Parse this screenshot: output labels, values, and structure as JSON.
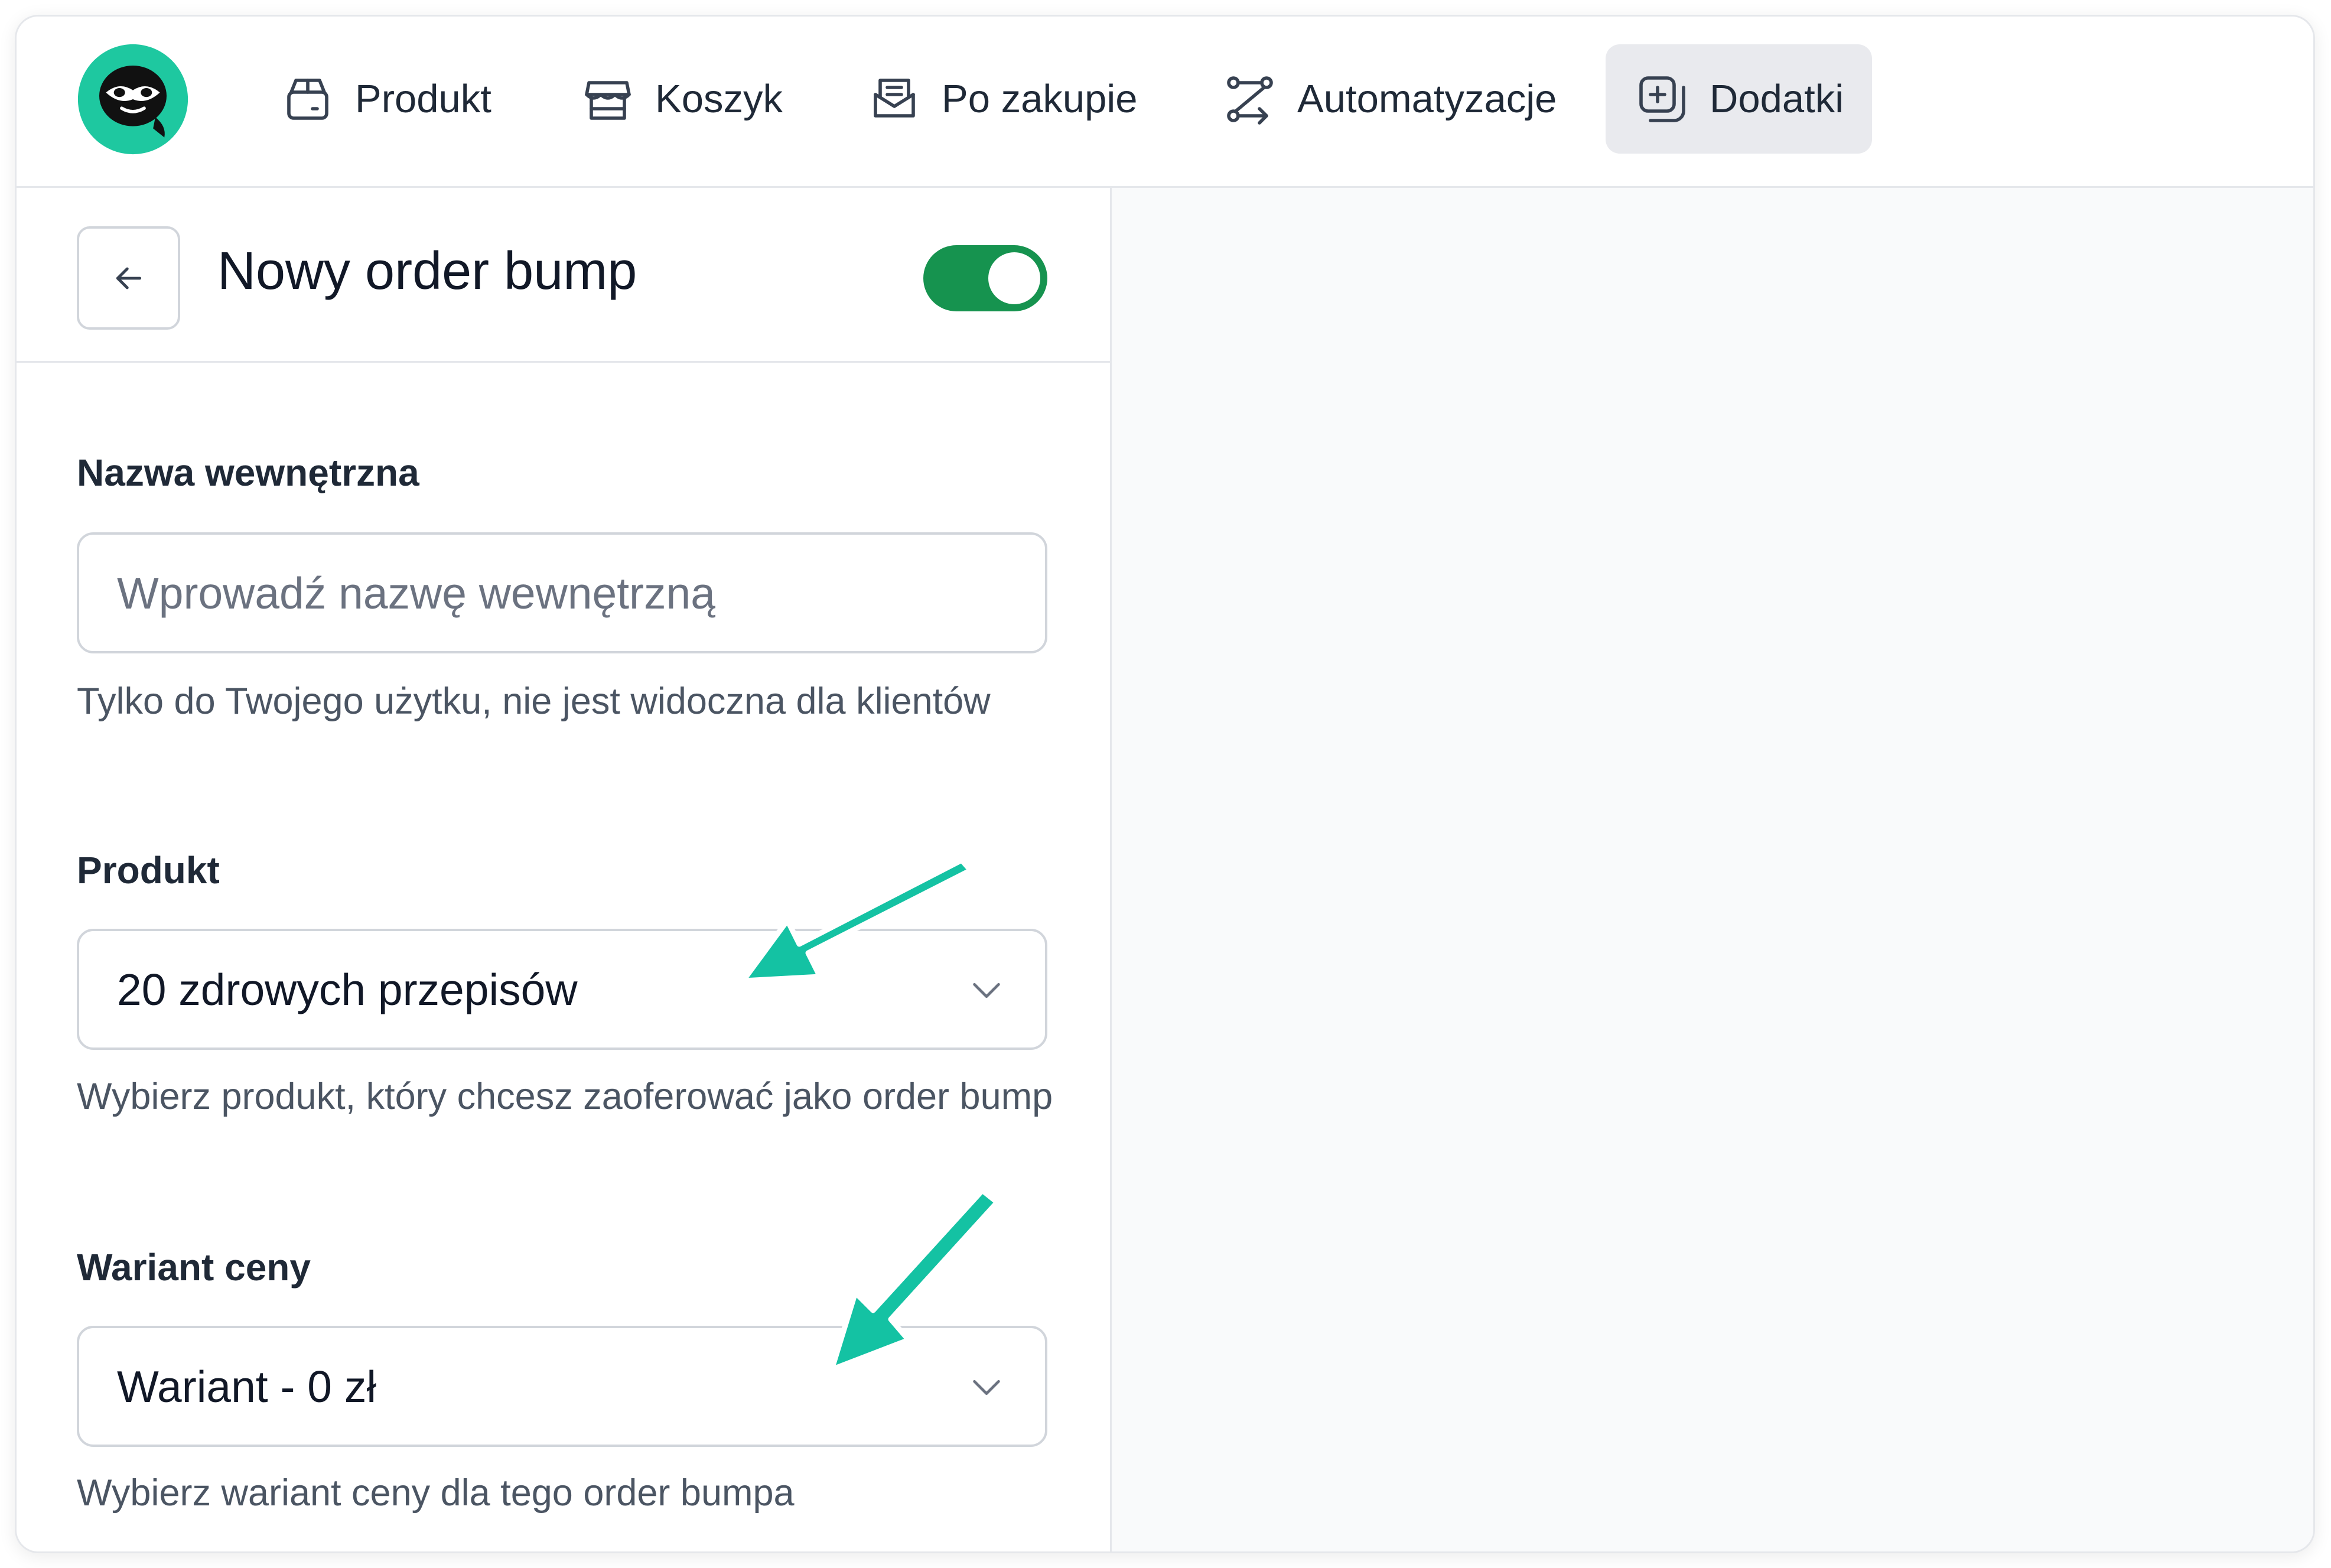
{
  "nav": {
    "items": [
      {
        "label": "Produkt",
        "icon": "package-icon"
      },
      {
        "label": "Koszyk",
        "icon": "store-icon"
      },
      {
        "label": "Po zakupie",
        "icon": "mail-open-icon"
      },
      {
        "label": "Automatyzacje",
        "icon": "workflow-icon"
      },
      {
        "label": "Dodatki",
        "icon": "square-plus-icon",
        "active": true
      }
    ]
  },
  "panel": {
    "title": "Nowy order bump",
    "enabled": true
  },
  "form": {
    "internal_name": {
      "label": "Nazwa wewnętrzna",
      "placeholder": "Wprowadź nazwę wewnętrzną",
      "value": "",
      "help": "Tylko do Twojego użytku, nie jest widoczna dla klientów"
    },
    "product": {
      "label": "Produkt",
      "value": "20 zdrowych przepisów",
      "help": "Wybierz produkt, który chcesz zaoferować jako order bump"
    },
    "price_variant": {
      "label": "Wariant ceny",
      "value": "Wariant - 0 zł",
      "help": "Wybierz wariant ceny dla tego order bumpa"
    }
  },
  "colors": {
    "accent": "#16934f",
    "logo": "#1ec8a0",
    "annotation_arrow": "#14c2a3",
    "right_panel_bg": "#f9fafb"
  }
}
